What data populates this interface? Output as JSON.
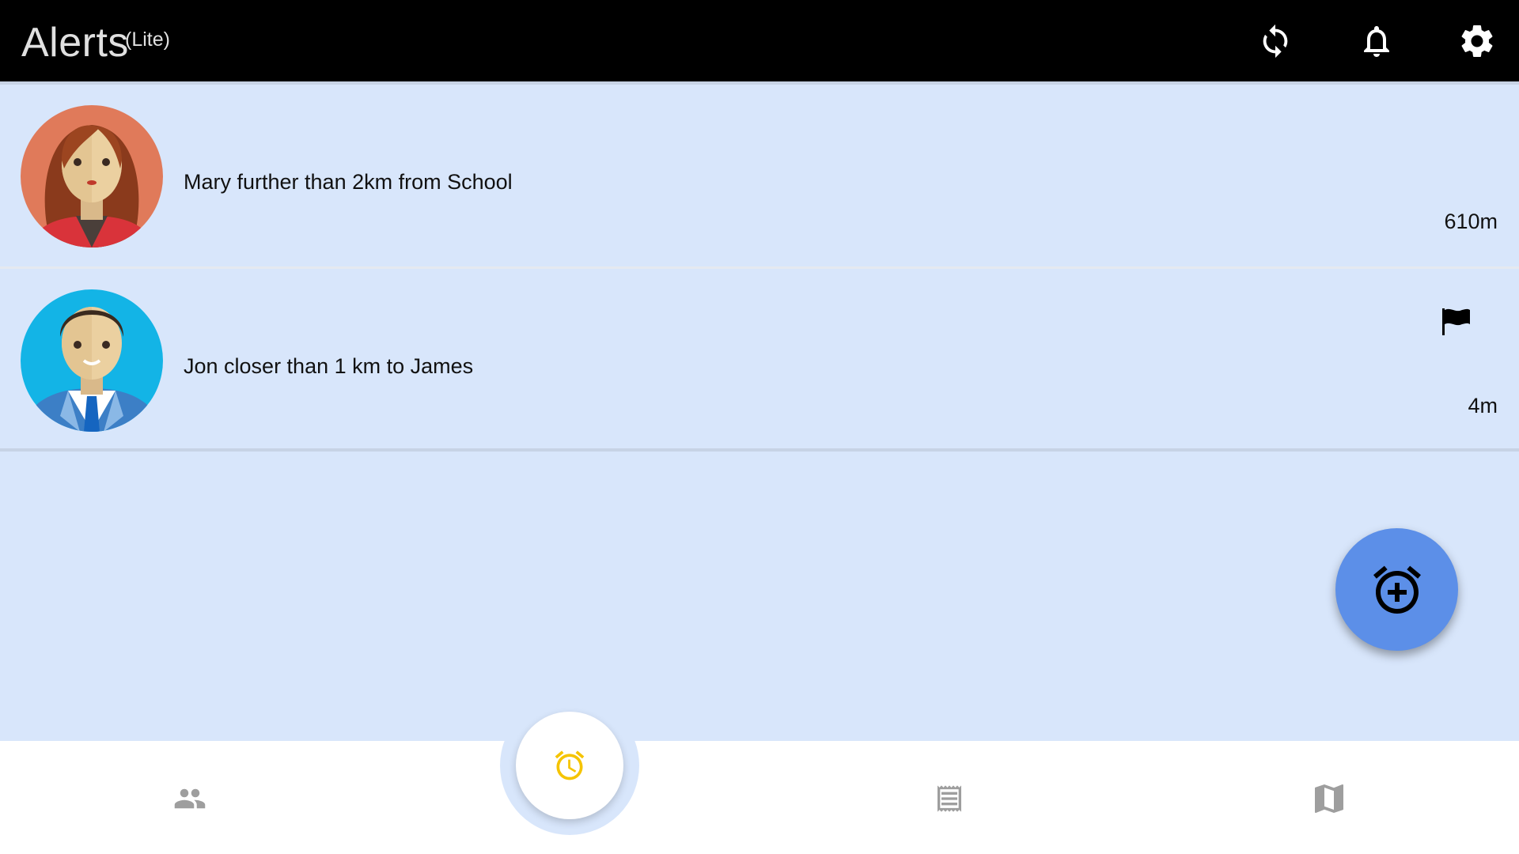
{
  "appbar": {
    "title": "Alerts",
    "subtitle": "(Lite)",
    "icons": [
      "refresh-icon",
      "bell-icon",
      "gear-icon"
    ]
  },
  "alerts": [
    {
      "text": "Mary further than 2km from School",
      "distance": "610m",
      "avatar": "woman-avatar",
      "flagged": false
    },
    {
      "text": "Jon closer than 1 km to James",
      "distance": "4m",
      "avatar": "man-avatar",
      "flagged": true
    }
  ],
  "fab": {
    "icon": "alarm-add-icon",
    "color": "#5c8fe8"
  },
  "bottom_nav": {
    "items": [
      "people-icon",
      "alarm-icon",
      "list-icon",
      "map-icon"
    ],
    "active": "alarm-icon",
    "active_color": "#f5c400",
    "inactive_color": "#9e9e9e"
  }
}
